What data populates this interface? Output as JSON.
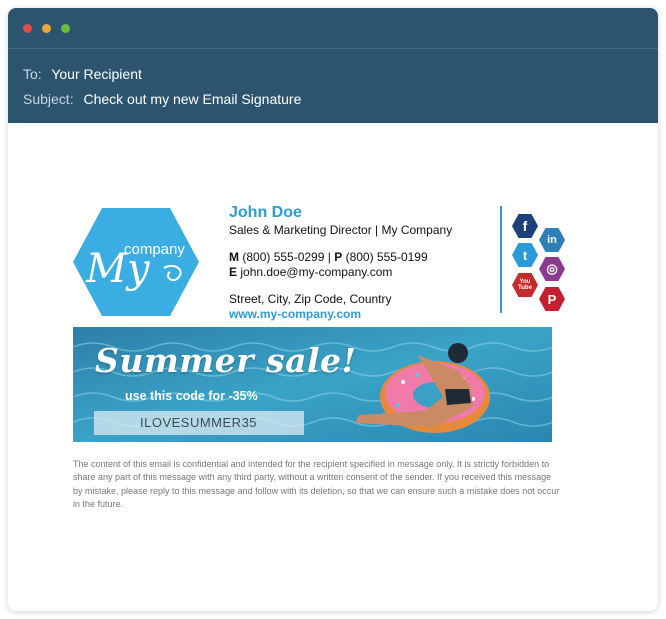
{
  "header": {
    "to_label": "To:",
    "to_value": "Your Recipient",
    "subject_label": "Subject:",
    "subject_value": "Check out my new Email Signature",
    "background": "#2d546f"
  },
  "logo": {
    "my_text": "My",
    "company_text": "company",
    "color": "#3aaee2"
  },
  "signature": {
    "name": "John Doe",
    "title": "Sales & Marketing Director | My Company",
    "mobile_label": "M",
    "mobile": "(800) 555-0299",
    "separator": "|",
    "phone_label": "P",
    "phone": "(800) 555-0199",
    "email_label": "E",
    "email": "john.doe@my-company.com",
    "address": "Street, City, Zip Code, Country",
    "website": "www.my-company.com",
    "accent": "#2f9bd6"
  },
  "social": {
    "facebook": {
      "icon": "facebook-icon",
      "glyph": "f",
      "color": "#1d3f7a"
    },
    "linkedin": {
      "icon": "linkedin-icon",
      "glyph": "in",
      "color": "#2d7fb8"
    },
    "twitter": {
      "icon": "twitter-icon",
      "glyph": "t",
      "color": "#2b9ad8"
    },
    "instagram": {
      "icon": "instagram-icon",
      "glyph": "◎",
      "color": "#8a3b8f"
    },
    "youtube": {
      "icon": "youtube-icon",
      "glyph": "You\nTube",
      "color": "#c42b2b"
    },
    "pinterest": {
      "icon": "pinterest-icon",
      "glyph": "P",
      "color": "#c41f2f"
    }
  },
  "banner": {
    "title": "Summer sale!",
    "subtitle": "use this code for -35%",
    "code": "ILOVESUMMER35"
  },
  "disclaimer": "The content of this email is confidential and intended for the recipient specified in message only. It is strictly forbidden to share any part of this message with any third party, without a written consent of the sender. If you received this message by mistake, please reply to this message and follow with its deletion, so that we can ensure such a mistake does not occur in the future."
}
